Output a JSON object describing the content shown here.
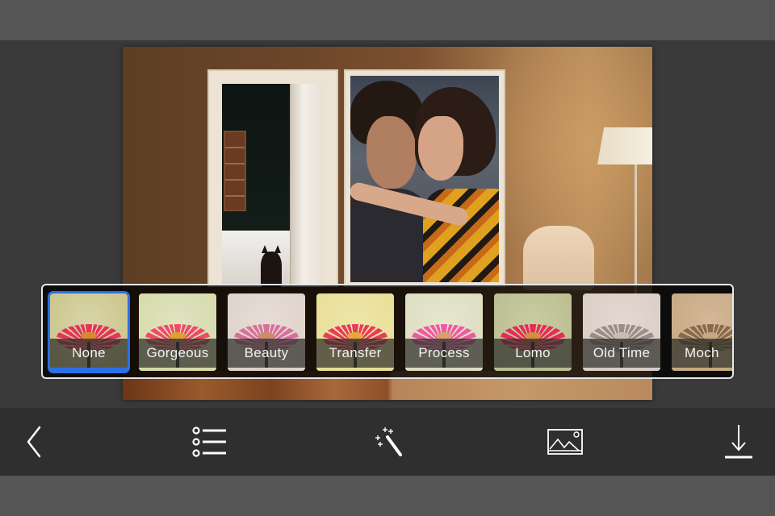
{
  "app": {
    "screen": "Photo frame editor - filter selection"
  },
  "filters": {
    "selected_index": 0,
    "items": [
      {
        "label": "None",
        "selected": true,
        "bg": "#d8d4a8",
        "petal": "#e8325a",
        "center": "#d98a2a",
        "stem": "#2a2a20",
        "base": "#c9c487"
      },
      {
        "label": "Gorgeous",
        "selected": false,
        "bg": "#dfe3c0",
        "petal": "#ef4a66",
        "center": "#e0a030",
        "stem": "#2a2a20",
        "base": "#d6d9a8"
      },
      {
        "label": "Beauty",
        "selected": false,
        "bg": "#e8ddd6",
        "petal": "#d9709a",
        "center": "#c8906a",
        "stem": "#3a2a2a",
        "base": "#ddd2c8"
      },
      {
        "label": "Transfer",
        "selected": false,
        "bg": "#eee6a8",
        "petal": "#ea3c58",
        "center": "#e8a640",
        "stem": "#2a2a20",
        "base": "#e8de96"
      },
      {
        "label": "Process",
        "selected": false,
        "bg": "#e6e6cf",
        "petal": "#f05aa0",
        "center": "#d8a070",
        "stem": "#2a2a20",
        "base": "#dcdcc0"
      },
      {
        "label": "Lomo",
        "selected": false,
        "bg": "#c8cca0",
        "petal": "#e82a56",
        "center": "#d09040",
        "stem": "#1e1e18",
        "base": "#b8bc90"
      },
      {
        "label": "Old Time",
        "selected": false,
        "bg": "#e4d8d0",
        "petal": "#9a8e88",
        "center": "#c8bcb4",
        "stem": "#3a3430",
        "base": "#d8ccc4"
      },
      {
        "label": "Moch",
        "selected": false,
        "bg": "#d4b898",
        "petal": "#8a6a4c",
        "center": "#c8a880",
        "stem": "#2e2418",
        "base": "#c4a880"
      }
    ]
  },
  "toolbar": {
    "items": [
      {
        "name": "back",
        "icon": "chevron-left-icon"
      },
      {
        "name": "frames-list",
        "icon": "list-icon"
      },
      {
        "name": "effects",
        "icon": "magic-wand-icon"
      },
      {
        "name": "gallery",
        "icon": "image-icon"
      },
      {
        "name": "save",
        "icon": "download-icon"
      }
    ]
  },
  "colors": {
    "selection_accent": "#2d6fe6",
    "toolbar_bg": "#2f2f2f",
    "chrome_bg": "#555555",
    "workspace_bg": "#3a3a3a"
  }
}
